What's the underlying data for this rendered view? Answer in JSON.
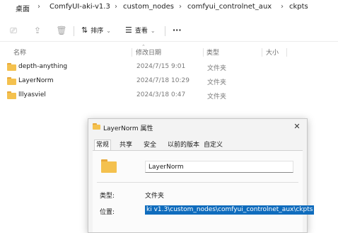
{
  "breadcrumb": [
    "桌面",
    "ComfyUI-aki-v1.3",
    "custom_nodes",
    "comfyui_controlnet_aux",
    "ckpts"
  ],
  "toolbar": {
    "sort_label": "排序",
    "view_label": "查看",
    "more_label": "···"
  },
  "columns": {
    "name": "名称",
    "date": "修改日期",
    "type": "类型",
    "size": "大小"
  },
  "files": [
    {
      "name": "depth-anything",
      "date": "2024/7/15 9:01",
      "type": "文件夹"
    },
    {
      "name": "LayerNorm",
      "date": "2024/7/18 10:29",
      "type": "文件夹"
    },
    {
      "name": "lllyasviel",
      "date": "2024/3/18 0:47",
      "type": "文件夹"
    }
  ],
  "dialog": {
    "title": "LayerNorm 属性",
    "tabs": [
      "常规",
      "共享",
      "安全",
      "以前的版本",
      "自定义"
    ],
    "active_tab": "常规",
    "folder_name": "LayerNorm",
    "type_label": "类型:",
    "type_value": "文件夹",
    "location_label": "位置:",
    "location_value": "ki v1.3\\custom_nodes\\comfyui_controlnet_aux\\ckpts"
  },
  "colors": {
    "accent": "#0f6cbd",
    "folder": "#f4c14e"
  }
}
